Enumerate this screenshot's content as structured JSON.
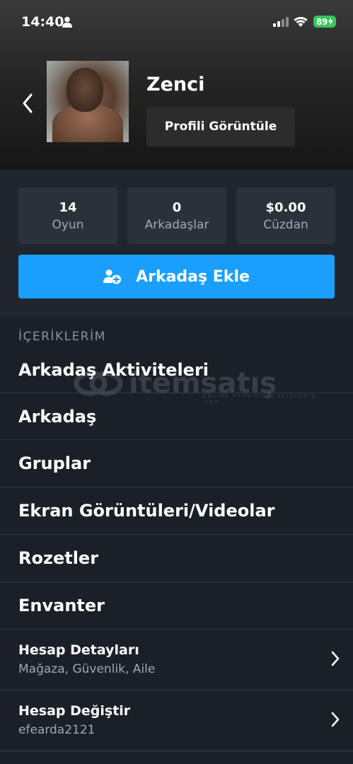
{
  "status_bar": {
    "time": "14:40",
    "battery": "89"
  },
  "profile": {
    "username": "Zenci",
    "view_profile_label": "Profili Görüntüle"
  },
  "stats": [
    {
      "value": "14",
      "label": "Oyun"
    },
    {
      "value": "0",
      "label": "Arkadaşlar"
    },
    {
      "value": "$0.00",
      "label": "Cüzdan"
    }
  ],
  "add_friend_label": "Arkadaş Ekle",
  "section_title": "İÇERİKLERİM",
  "menu": [
    "Arkadaş Aktiviteleri",
    "Arkadaş",
    "Gruplar",
    "Ekran Görüntüleri/Videolar",
    "Rozetler",
    "Envanter"
  ],
  "account": [
    {
      "title": "Hesap Detayları",
      "subtitle": "Mağaza, Güvenlik, Aile"
    },
    {
      "title": "Hesap Değiştir",
      "subtitle": "efearda2121"
    }
  ],
  "watermark": {
    "text": "itemsatış",
    "sub": "ONLINE·OYUN·OYUN·ALIŞVERİŞ .com"
  },
  "colors": {
    "accent": "#1a9fff",
    "battery": "#34c759",
    "background": "#1b2028"
  }
}
